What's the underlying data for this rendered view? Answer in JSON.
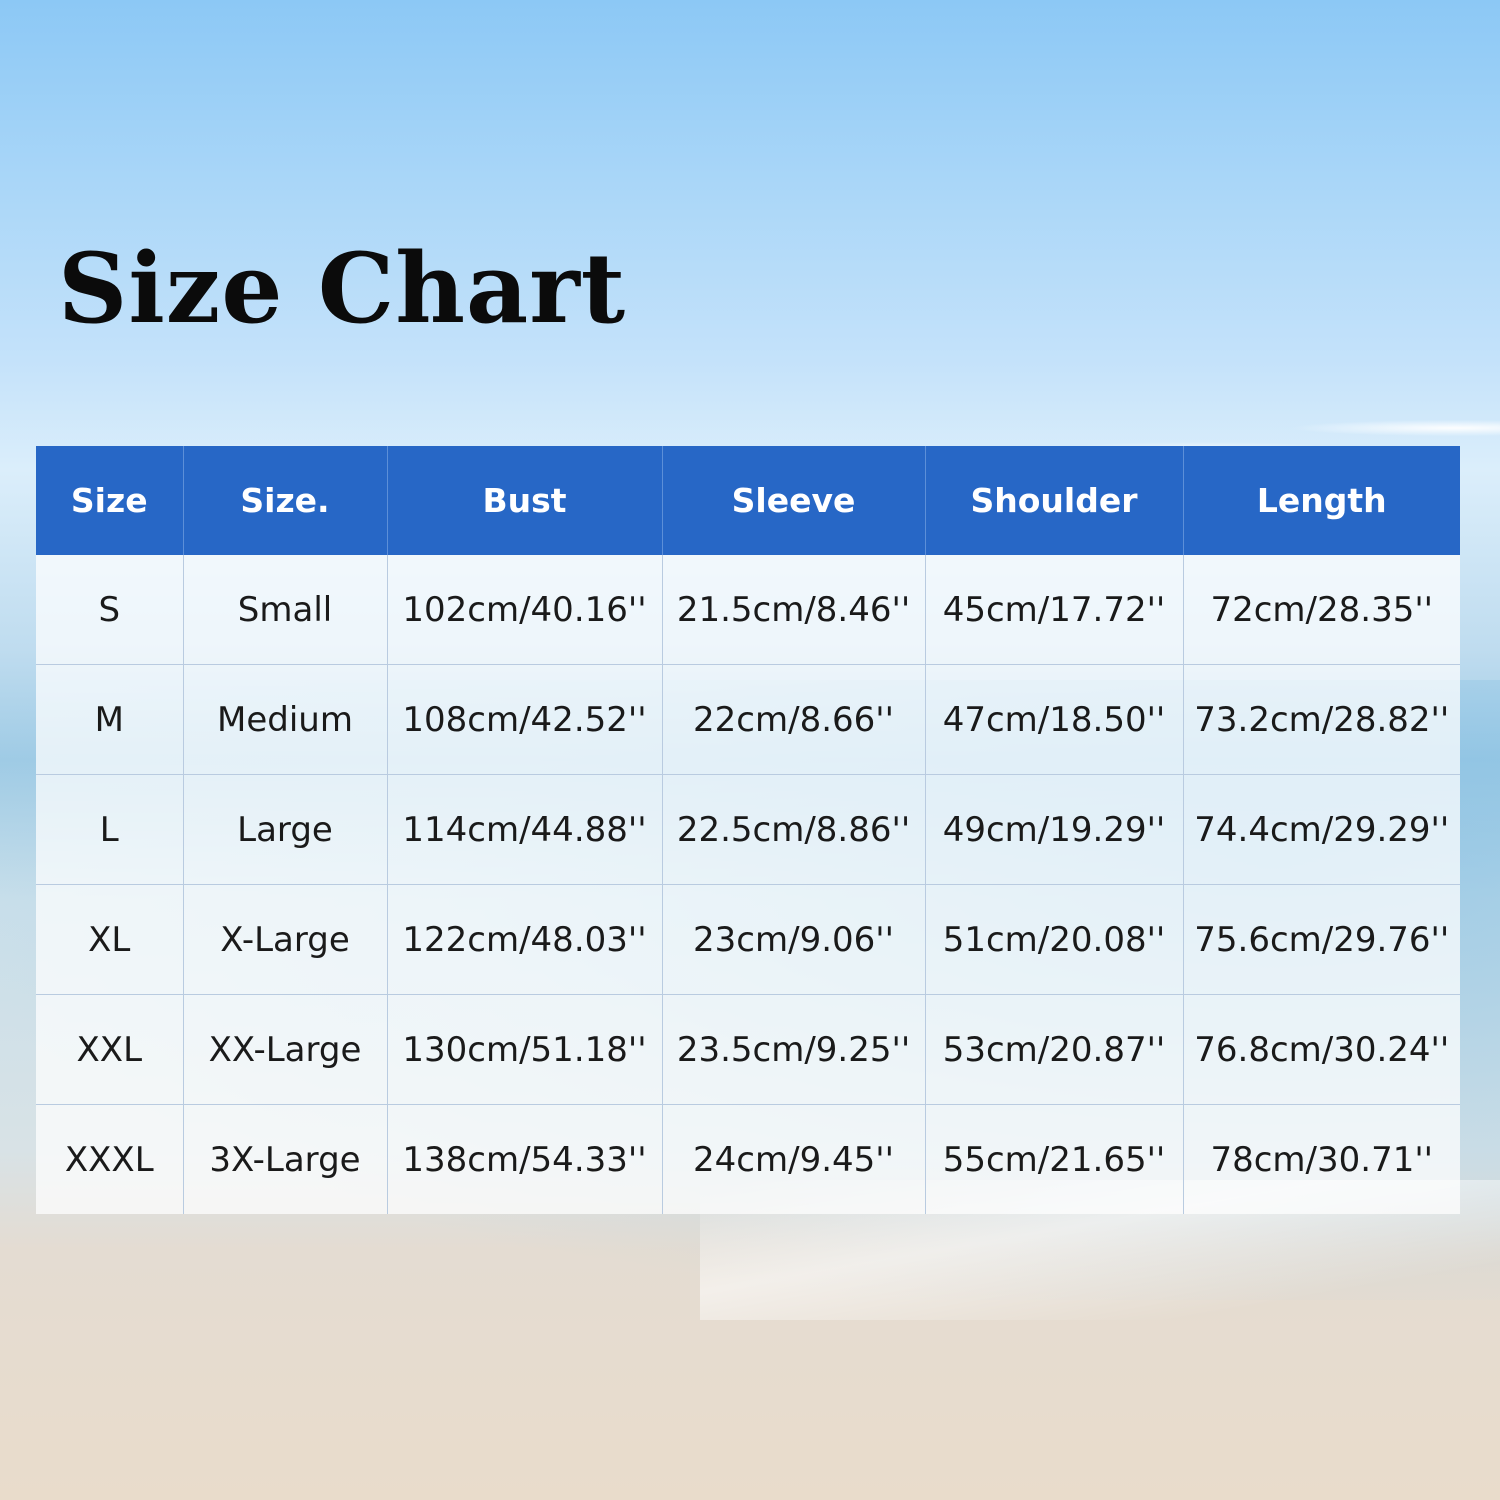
{
  "title": "Size Chart",
  "colors": {
    "header_bg": "#2767c6",
    "header_text": "#ffffff",
    "cell_text": "#1a1a1a"
  },
  "chart_data": {
    "type": "table",
    "title": "Size Chart",
    "columns": [
      "Size",
      "Size.",
      "Bust",
      "Sleeve",
      "Shoulder",
      "Length"
    ],
    "rows": [
      [
        "S",
        "Small",
        "102cm/40.16''",
        "21.5cm/8.46''",
        "45cm/17.72''",
        "72cm/28.35''"
      ],
      [
        "M",
        "Medium",
        "108cm/42.52''",
        "22cm/8.66''",
        "47cm/18.50''",
        "73.2cm/28.82''"
      ],
      [
        "L",
        "Large",
        "114cm/44.88''",
        "22.5cm/8.86''",
        "49cm/19.29''",
        "74.4cm/29.29''"
      ],
      [
        "XL",
        "X-Large",
        "122cm/48.03''",
        "23cm/9.06''",
        "51cm/20.08''",
        "75.6cm/29.76''"
      ],
      [
        "XXL",
        "XX-Large",
        "130cm/51.18''",
        "23.5cm/9.25''",
        "53cm/20.87''",
        "76.8cm/30.24''"
      ],
      [
        "XXXL",
        "3X-Large",
        "138cm/54.33''",
        "24cm/9.45''",
        "55cm/21.65''",
        "78cm/30.71''"
      ]
    ]
  }
}
